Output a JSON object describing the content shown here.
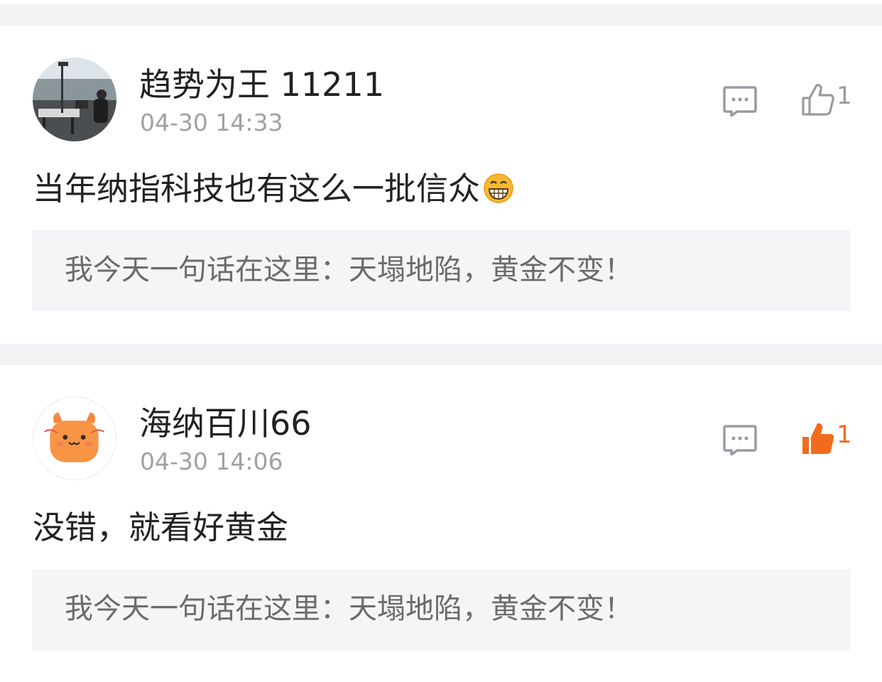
{
  "comments": [
    {
      "username": "趋势为王 11211",
      "time": "04-30 14:33",
      "text": "当年纳指科技也有这么一批信众",
      "emoji": "grinning-face",
      "likes": "1",
      "liked": false,
      "quote": "我今天一句话在这里：天塌地陷，黄金不变！"
    },
    {
      "username": "海纳百川66",
      "time": "04-30 14:06",
      "text": "没错，就看好黄金",
      "likes": "1",
      "liked": true,
      "quote": "我今天一句话在这里：天塌地陷，黄金不变！"
    }
  ],
  "colors": {
    "liked": "#f26b1d",
    "icon": "#9a9aa0",
    "secondary_text": "#a0a0a6",
    "quote_bg": "#f5f5f7",
    "separator": "#f2f2f4"
  },
  "icons": {
    "reply": "comment-bubble-icon",
    "like": "thumbs-up-icon"
  }
}
